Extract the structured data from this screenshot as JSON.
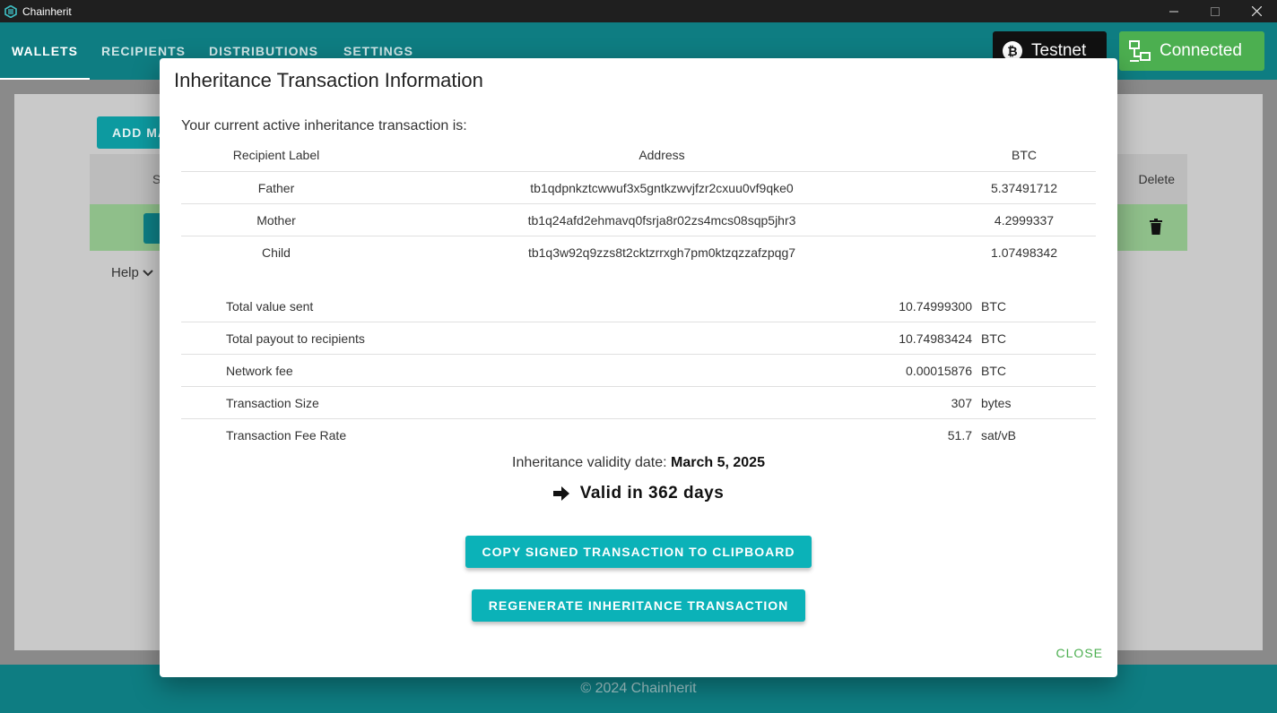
{
  "window": {
    "title": "Chainherit",
    "controls": [
      "minimize-icon",
      "maximize-icon",
      "close-icon"
    ]
  },
  "nav": {
    "tabs": [
      {
        "label": "WALLETS",
        "active": true
      },
      {
        "label": "RECIPIENTS",
        "active": false
      },
      {
        "label": "DISTRIBUTIONS",
        "active": false
      },
      {
        "label": "SETTINGS",
        "active": false
      }
    ],
    "network_label": "Testnet",
    "network_icon": "bitcoin-icon",
    "connection_label": "Connected",
    "connection_icon": "network-connected-icon"
  },
  "background": {
    "add_button_label": "ADD MA",
    "table_header_first": "S",
    "table_header_delete": "Delete",
    "help_label": "Help"
  },
  "footer": {
    "text": "© 2024 Chainherit"
  },
  "modal": {
    "title": "Inheritance Transaction Information",
    "intro": "Your current active inheritance transaction is:",
    "recipients_table": {
      "headers": [
        "Recipient Label",
        "Address",
        "BTC"
      ],
      "rows": [
        {
          "label": "Father",
          "address": "tb1qdpnkztcwwuf3x5gntkzwvjfzr2cxuu0vf9qke0",
          "btc": "5.37491712"
        },
        {
          "label": "Mother",
          "address": "tb1q24afd2ehmavq0fsrja8r02zs4mcs08sqp5jhr3",
          "btc": "4.2999337"
        },
        {
          "label": "Child",
          "address": "tb1q3w92q9zzs8t2cktzrrxgh7pm0ktzqzzafzpqg7",
          "btc": "1.07498342"
        }
      ]
    },
    "summary": [
      {
        "label": "Total value sent",
        "value": "10.74999300",
        "unit": "BTC"
      },
      {
        "label": "Total payout to recipients",
        "value": "10.74983424",
        "unit": "BTC"
      },
      {
        "label": "Network fee",
        "value": "0.00015876",
        "unit": "BTC"
      },
      {
        "label": "Transaction Size",
        "value": "307",
        "unit": "bytes"
      },
      {
        "label": "Transaction Fee Rate",
        "value": "51.7",
        "unit": "sat/vB"
      }
    ],
    "validity_label": "Inheritance validity date:",
    "validity_date": "March 5, 2025",
    "valid_in": "Valid in 362 days",
    "copy_button": "COPY SIGNED TRANSACTION TO CLIPBOARD",
    "regenerate_button": "REGENERATE INHERITANCE TRANSACTION",
    "close_button": "CLOSE"
  },
  "colors": {
    "nav_teal": "#0e7d82",
    "button_teal": "#0bb2b8",
    "connected_green": "#4caf50",
    "close_green": "#4caf50"
  }
}
